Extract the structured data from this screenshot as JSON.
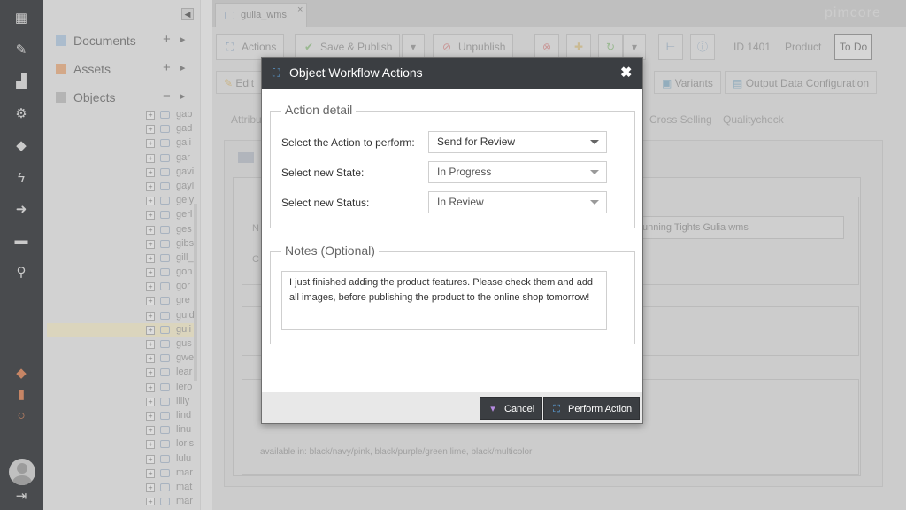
{
  "app": {
    "brand": "pimcore"
  },
  "tree": {
    "sections": [
      {
        "label": "Documents",
        "icon": "document-icon"
      },
      {
        "label": "Assets",
        "icon": "folder-icon"
      },
      {
        "label": "Objects",
        "icon": "objects-icon"
      }
    ],
    "items": [
      "gab",
      "gad",
      "gali",
      "gar",
      "gavi",
      "gayl",
      "gely",
      "gerl",
      "ges",
      "gibs",
      "gill_",
      "gon",
      "gor",
      "gre",
      "guid",
      "guli",
      "gus",
      "gwe",
      "lear",
      "lero",
      "lilly",
      "lind",
      "linu",
      "loris",
      "lulu",
      "mar",
      "mat",
      "mar"
    ],
    "selected_index": 15
  },
  "editor": {
    "tab_title": "gulia_wms",
    "toolbar": {
      "actions": "Actions",
      "save_publish": "Save & Publish",
      "unpublish": "Unpublish",
      "id": "ID 1401",
      "class": "Product",
      "todo": "To Do"
    },
    "subtabs": [
      "Edit",
      "Variants",
      "Output Data Configuration"
    ],
    "attr_tabs": [
      "Attribu",
      "Cross Selling",
      "Qualitycheck"
    ],
    "field_value": "unning Tights Gulia wms",
    "available_in": "available in: black/navy/pink, black/purple/green lime, black/multicolor",
    "left_labels": [
      "N",
      "C"
    ]
  },
  "dialog": {
    "title": "Object Workflow Actions",
    "action_detail": {
      "legend": "Action detail",
      "rows": [
        {
          "label": "Select the Action to perform:",
          "value": "Send for Review"
        },
        {
          "label": "Select new State:",
          "value": "In Progress"
        },
        {
          "label": "Select new Status:",
          "value": "In Review"
        }
      ]
    },
    "notes": {
      "legend": "Notes (Optional)",
      "text": "I just finished adding the product features. Please check them and add all images, before publishing the product to the online shop tomorrow!"
    },
    "buttons": {
      "cancel": "Cancel",
      "perform": "Perform Action"
    }
  }
}
